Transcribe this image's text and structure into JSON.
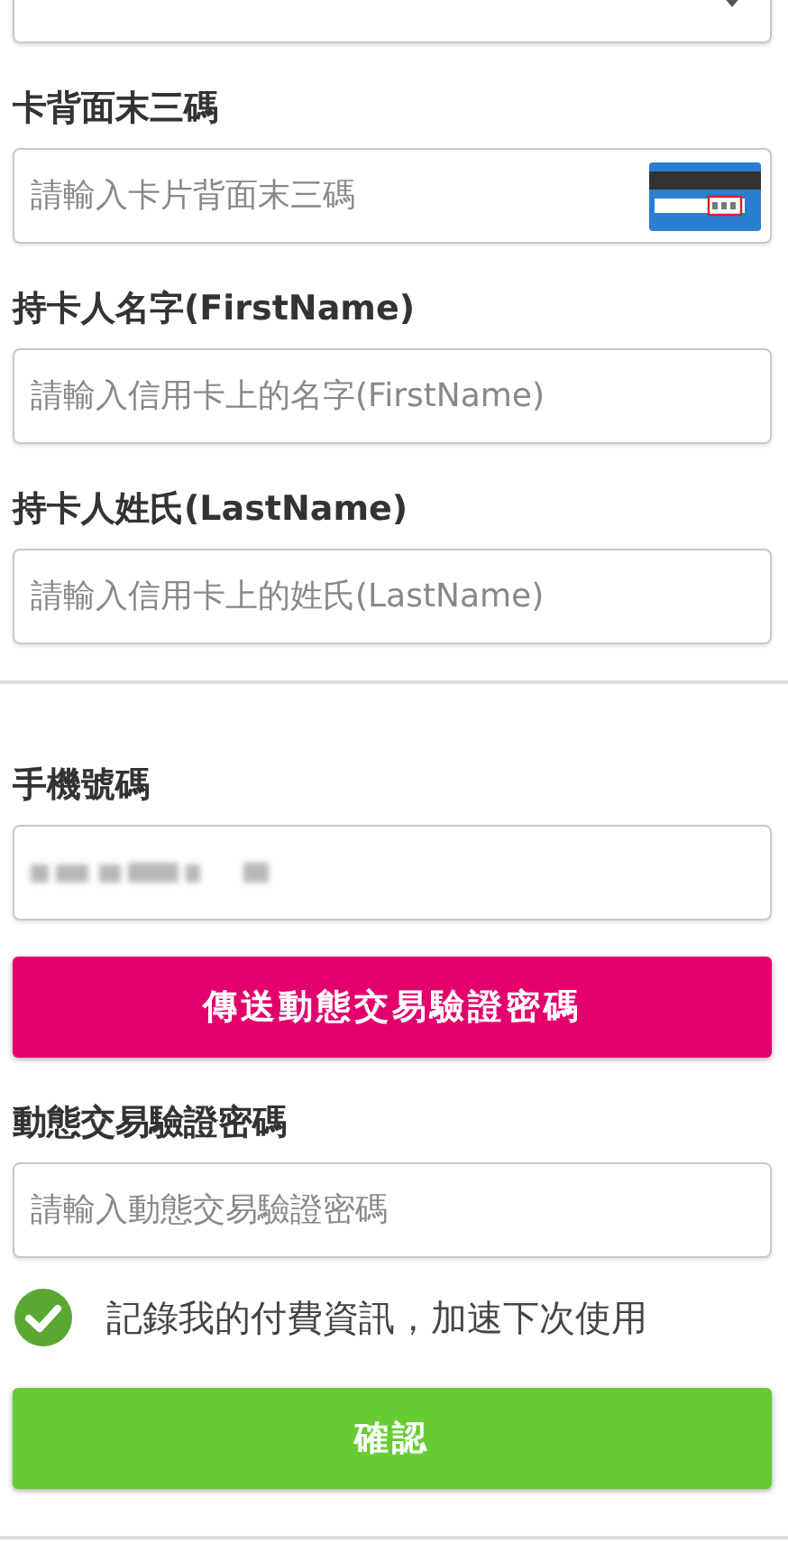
{
  "year_select": {
    "expanded": false
  },
  "sections": [
    {
      "kind": "fields",
      "fields": [
        {
          "kind": "card",
          "label": "卡背面末三碼",
          "placeholder": "請輸入卡片背面末三碼"
        },
        {
          "kind": "text",
          "label": "持卡人名字(FirstName)",
          "placeholder": "請輸入信用卡上的名字(FirstName)"
        },
        {
          "kind": "text",
          "label": "持卡人姓氏(LastName)",
          "placeholder": "請輸入信用卡上的姓氏(LastName)"
        }
      ]
    },
    {
      "kind": "fields",
      "fields": [
        {
          "kind": "redacted",
          "label": "手機號碼"
        }
      ]
    }
  ],
  "send_button": "傳送動態交易驗證密碼",
  "otp": {
    "label": "動態交易驗證密碼",
    "placeholder": "請輸入動態交易驗證密碼"
  },
  "remember": {
    "label": "記錄我的付費資訊，加速下次使用",
    "checked": true
  },
  "confirm_button": "確認"
}
